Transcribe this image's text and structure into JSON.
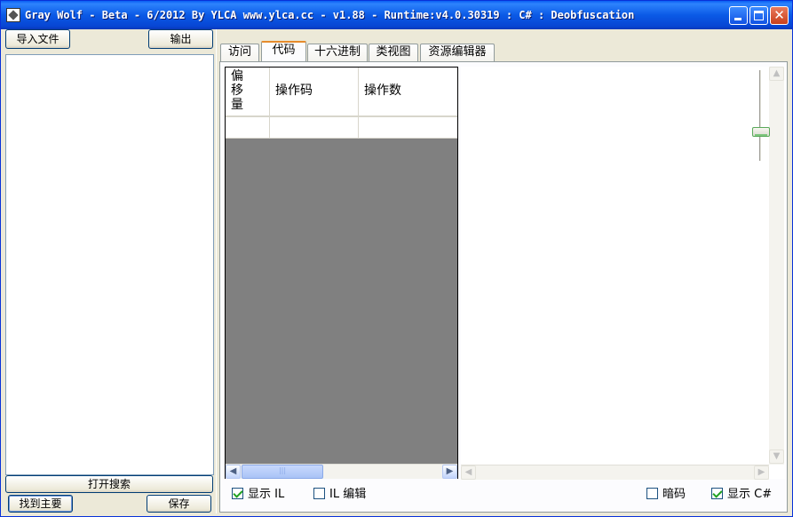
{
  "window": {
    "title": "Gray Wolf - Beta - 6/2012  By YLCA  www.ylca.cc - v1.88 - Runtime:v4.0.30319 : C# : Deobfuscation"
  },
  "left_panel": {
    "import_button": "导入文件",
    "export_button": "输出",
    "open_search_button": "打开搜索",
    "find_main_button": "找到主要",
    "save_button": "保存"
  },
  "tabs": [
    {
      "label": "访问"
    },
    {
      "label": "代码"
    },
    {
      "label": "十六进制"
    },
    {
      "label": "类视图"
    },
    {
      "label": "资源编辑器"
    }
  ],
  "active_tab": "代码",
  "il_grid": {
    "columns": [
      "偏\n移\n量",
      "操作码",
      "操作数"
    ],
    "rows": [
      [
        "",
        "",
        ""
      ]
    ]
  },
  "options": {
    "show_il": {
      "label": "显示 IL",
      "checked": true
    },
    "il_edit": {
      "label": "IL 编辑",
      "checked": false
    },
    "dark_code": {
      "label": "暗码",
      "checked": false
    },
    "show_csharp": {
      "label": "显示 C#",
      "checked": true
    }
  },
  "icons": {
    "app": "wolf-app-icon",
    "minimize": "minimize-icon",
    "maximize": "maximize-icon",
    "close": "close-icon",
    "scroll_left": "chevron-left-icon",
    "scroll_right": "chevron-right-icon"
  }
}
